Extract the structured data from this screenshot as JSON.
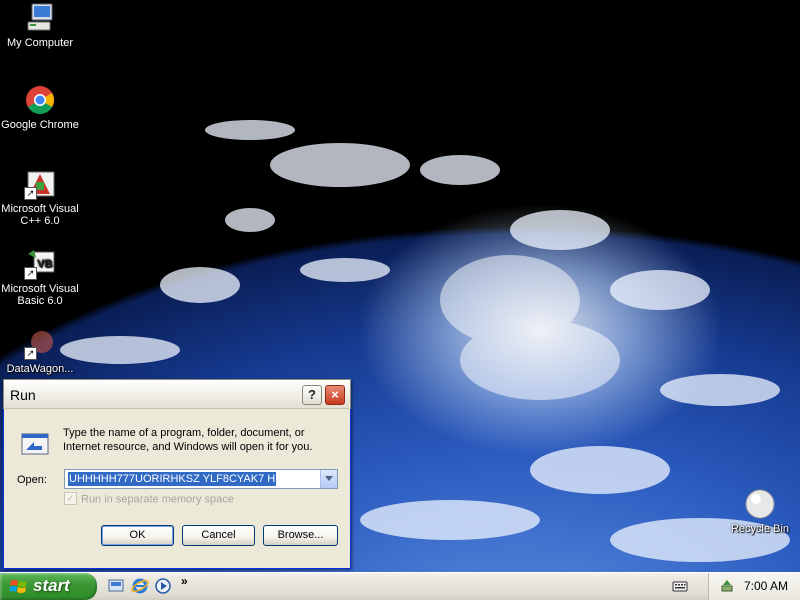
{
  "desktop": {
    "icons": [
      {
        "label": "My Computer",
        "icon": "my-computer-icon"
      },
      {
        "label": "Google Chrome",
        "icon": "chrome-icon"
      },
      {
        "label": "Microsoft Visual C++ 6.0",
        "icon": "visual-cpp-icon"
      },
      {
        "label": "Microsoft Visual Basic 6.0",
        "icon": "visual-basic-icon"
      },
      {
        "label": "DataWagon...",
        "icon": "datawagon-icon"
      },
      {
        "label": "Recycle Bin",
        "icon": "recycle-bin-icon"
      }
    ]
  },
  "run_dialog": {
    "title": "Run",
    "help_label": "?",
    "close_label": "×",
    "description": "Type the name of a program, folder, document, or Internet resource, and Windows will open it for you.",
    "open_label": "Open:",
    "open_value": "UHHHHH777UORIRHKSZ YLF8CYAK7 H",
    "memory_label": "Run in separate memory space",
    "memory_checked": "✓",
    "ok_label": "OK",
    "cancel_label": "Cancel",
    "browse_label": "Browse..."
  },
  "taskbar": {
    "start_label": "start",
    "quick_launch_more": "»",
    "quick_launch": [
      "show-desktop-icon",
      "internet-explorer-icon",
      "media-player-icon"
    ],
    "tray_icon": "safely-remove-hardware-icon",
    "keyboard_icon": "keyboard-icon",
    "clock": "7:00 AM"
  },
  "colors": {
    "titlebar_border": "#0831d9",
    "start_green": "#3c9a36",
    "selection_blue": "#316ac5",
    "close_red": "#c83a1f"
  }
}
